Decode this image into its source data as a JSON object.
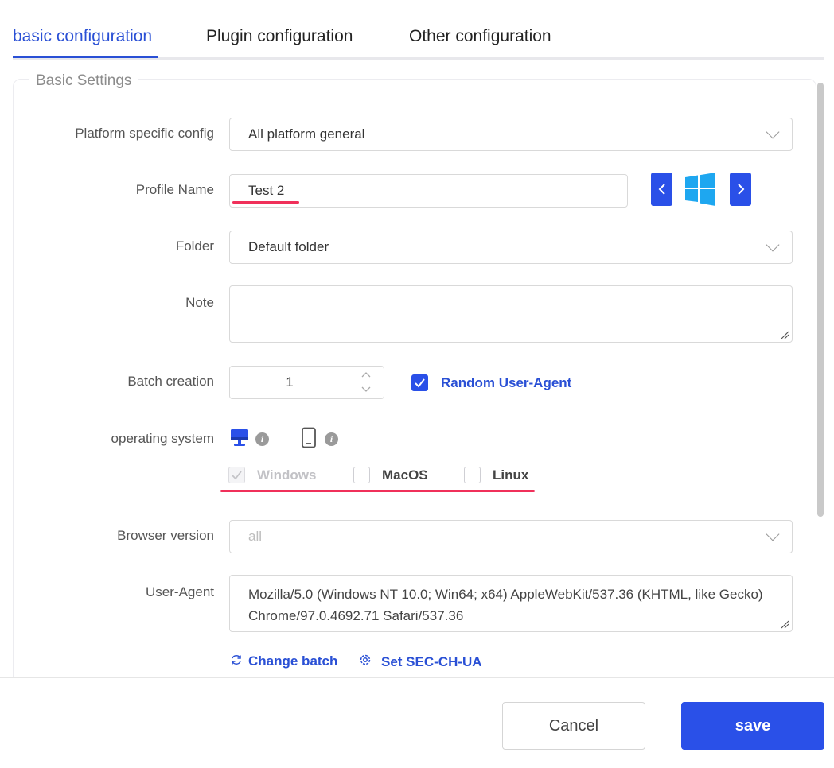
{
  "tabs": [
    {
      "label": "basic configuration",
      "active": true
    },
    {
      "label": "Plugin configuration",
      "active": false
    },
    {
      "label": "Other configuration",
      "active": false
    }
  ],
  "section": {
    "legend": "Basic Settings"
  },
  "form": {
    "platform": {
      "label": "Platform specific config",
      "value": "All platform general"
    },
    "profile_name": {
      "label": "Profile Name",
      "value": "Test 2",
      "prev_icon": "chevron-left-icon",
      "os_icon": "windows-logo-icon",
      "next_icon": "chevron-right-icon"
    },
    "folder": {
      "label": "Folder",
      "value": "Default folder"
    },
    "note": {
      "label": "Note",
      "value": ""
    },
    "batch": {
      "label": "Batch creation",
      "value": "1",
      "random_ua_label": "Random User-Agent",
      "random_ua_checked": true
    },
    "os": {
      "label": "operating system",
      "desktop_icon": "desktop-icon",
      "mobile_icon": "mobile-icon",
      "options": [
        {
          "label": "Windows",
          "checked": true,
          "disabled": true
        },
        {
          "label": "MacOS",
          "checked": false,
          "disabled": false
        },
        {
          "label": "Linux",
          "checked": false,
          "disabled": false
        }
      ]
    },
    "browser_version": {
      "label": "Browser version",
      "placeholder": "all"
    },
    "user_agent": {
      "label": "User-Agent",
      "value": "Mozilla/5.0 (Windows NT 10.0; Win64; x64) AppleWebKit/537.36 (KHTML, like Gecko) Chrome/97.0.4692.71 Safari/537.36"
    },
    "links": {
      "change_batch": "Change batch",
      "set_sec_ch_ua": "Set SEC-CH-UA"
    }
  },
  "footer": {
    "cancel_label": "Cancel",
    "save_label": "save"
  },
  "colors": {
    "accent": "#2a50e8",
    "annotation_red": "#f0305a",
    "windows_blue": "#1ea7f0"
  }
}
